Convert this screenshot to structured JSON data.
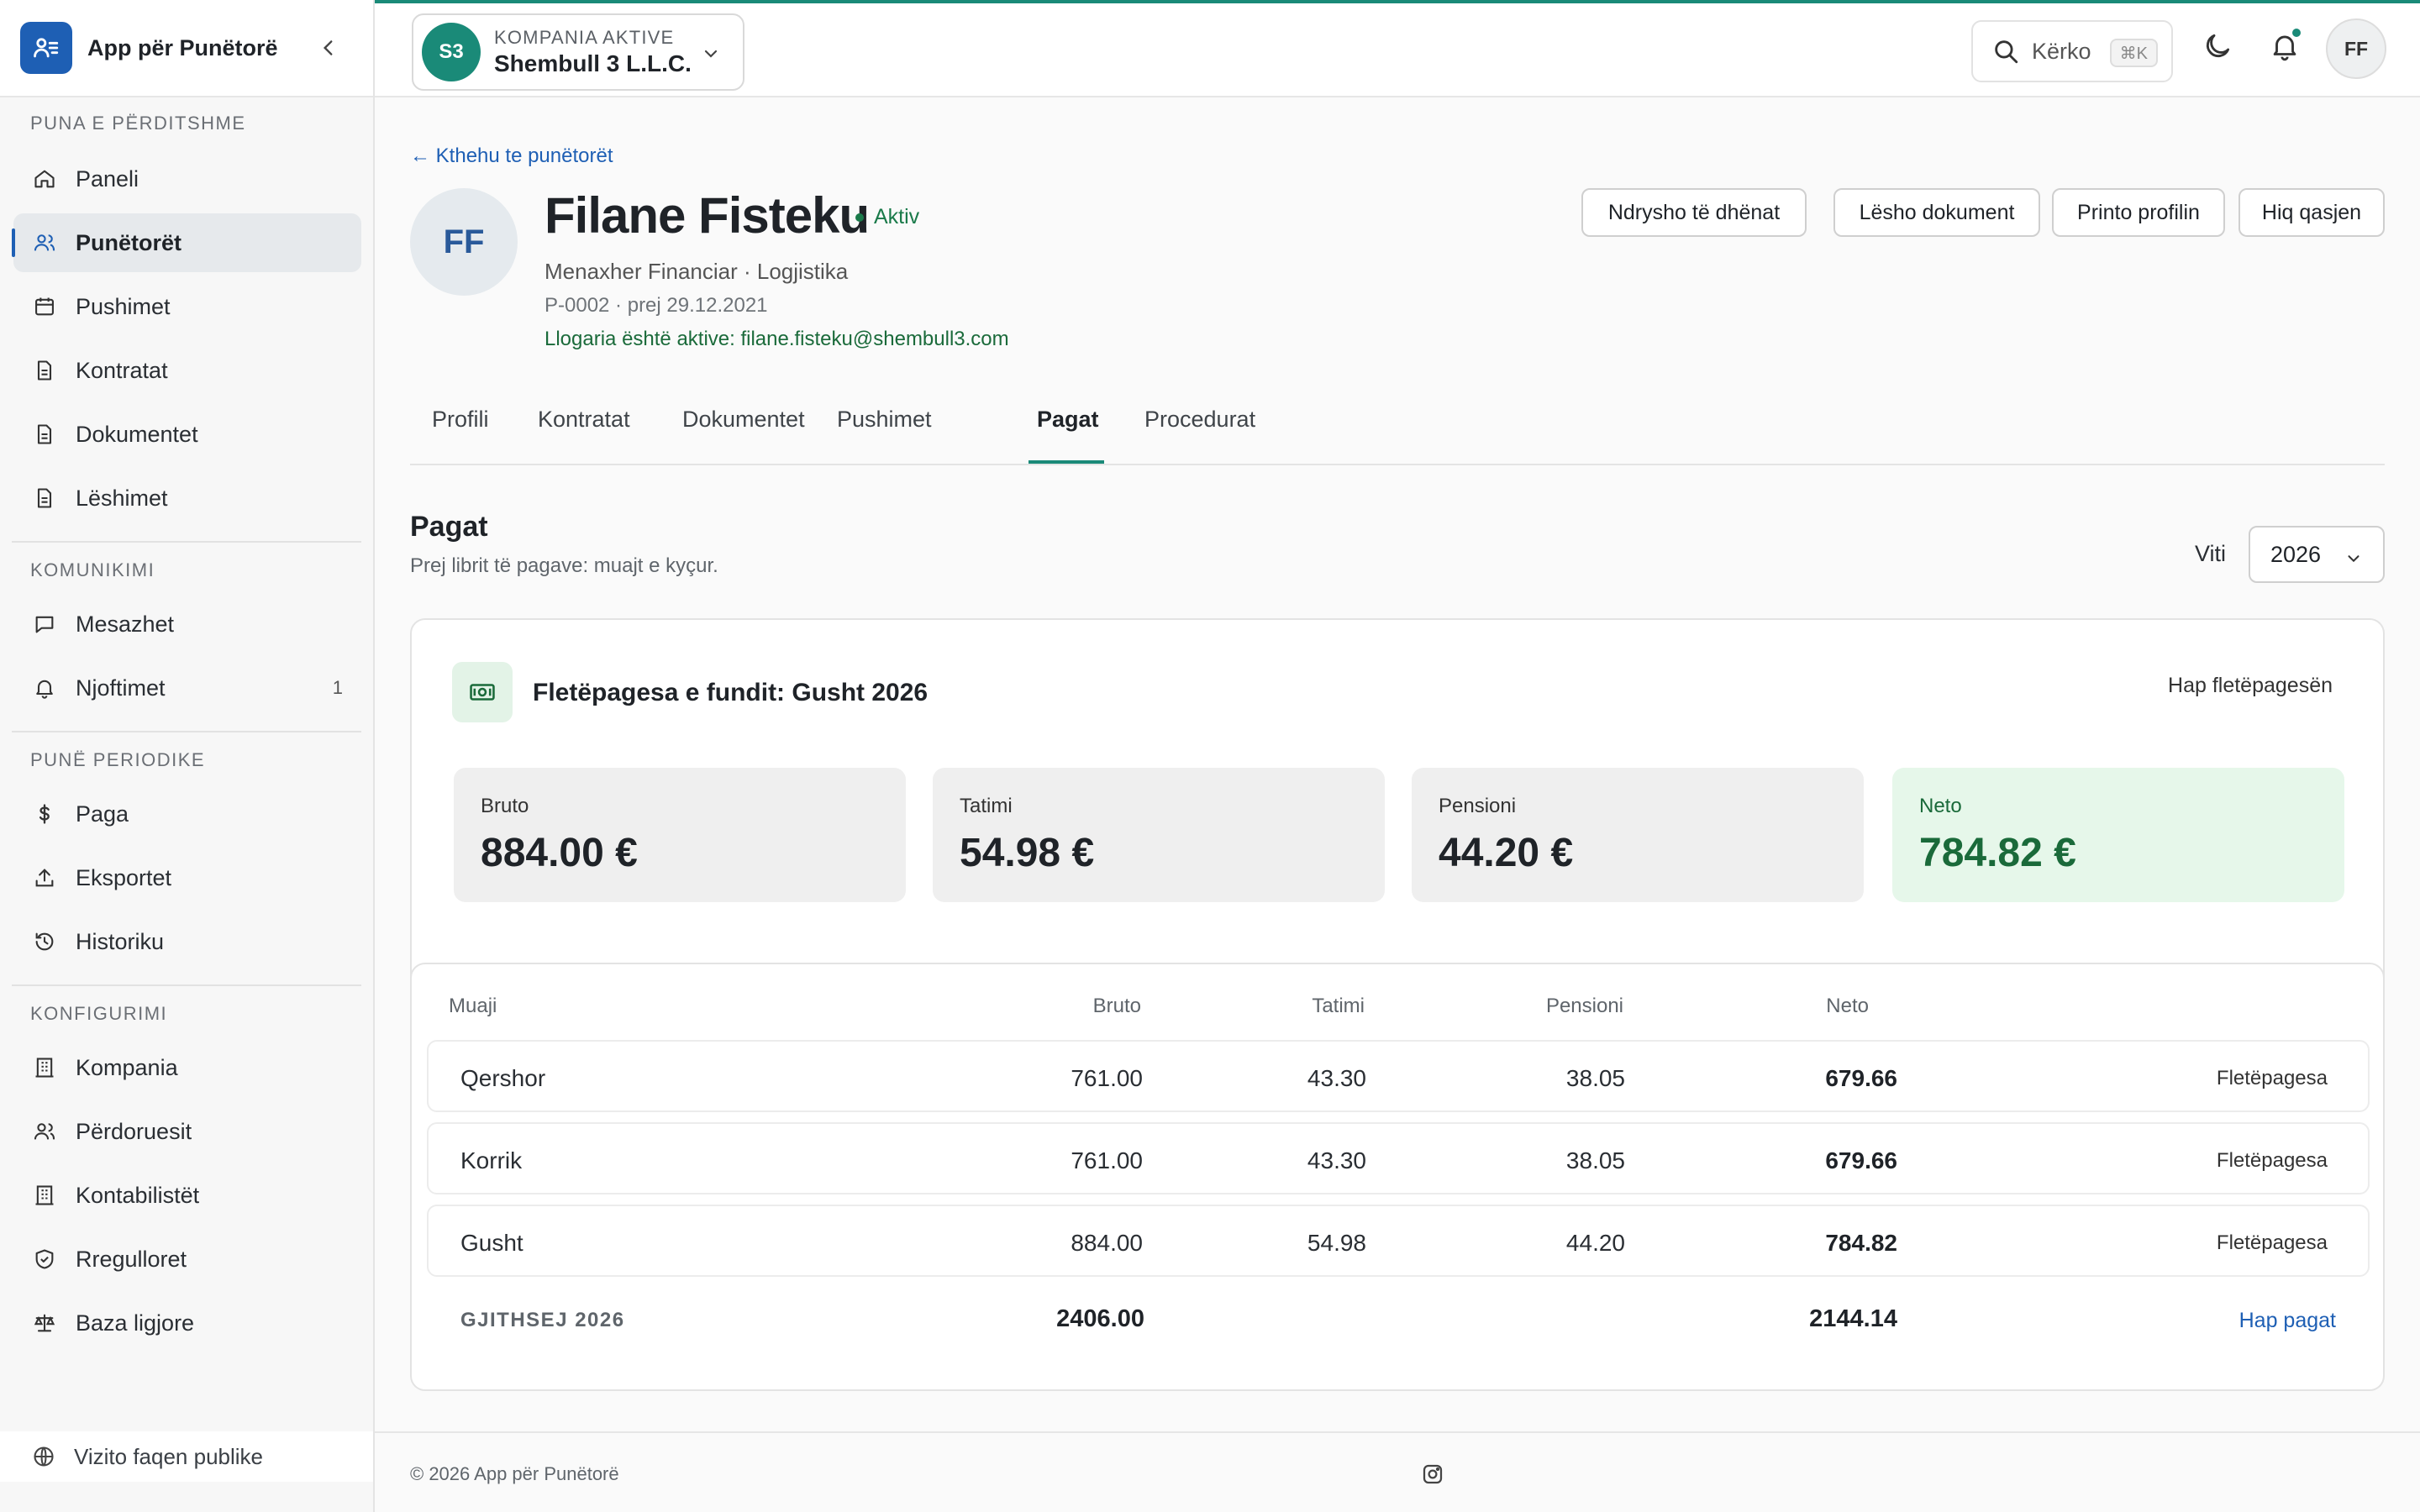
{
  "app": {
    "name": "App për Punëtorë"
  },
  "sidebar": {
    "sections": [
      {
        "title": "PUNA E PËRDITSHME"
      },
      {
        "title": "KOMUNIKIMI"
      },
      {
        "title": "PUNË PERIODIKE"
      },
      {
        "title": "KONFIGURIMI"
      }
    ],
    "items": [
      {
        "label": "Paneli",
        "icon": "home-icon"
      },
      {
        "label": "Punëtorët",
        "icon": "users-icon",
        "active": true
      },
      {
        "label": "Pushimet",
        "icon": "calendar-icon"
      },
      {
        "label": "Kontratat",
        "icon": "document-icon"
      },
      {
        "label": "Dokumentet",
        "icon": "document-icon"
      },
      {
        "label": "Lëshimet",
        "icon": "document-icon"
      },
      {
        "label": "Mesazhet",
        "icon": "message-icon"
      },
      {
        "label": "Njoftimet",
        "icon": "bell-icon",
        "count": "1"
      },
      {
        "label": "Paga",
        "icon": "dollar-icon"
      },
      {
        "label": "Eksportet",
        "icon": "upload-icon"
      },
      {
        "label": "Historiku",
        "icon": "history-icon"
      },
      {
        "label": "Kompania",
        "icon": "building-icon"
      },
      {
        "label": "Përdoruesit",
        "icon": "users-icon"
      },
      {
        "label": "Kontabilistët",
        "icon": "building-icon"
      },
      {
        "label": "Rregulloret",
        "icon": "shield-icon"
      },
      {
        "label": "Baza ligjore",
        "icon": "scale-icon"
      }
    ],
    "public_link": "Vizito faqen publike"
  },
  "header": {
    "company_label": "KOMPANIA AKTIVE",
    "company_name": "Shembull 3 L.L.C.",
    "company_initials": "S3",
    "search_label": "Kërko",
    "search_shortcut": "⌘K",
    "user_initials": "FF"
  },
  "employee": {
    "back_link": "← Kthehu te punëtorët",
    "initials": "FF",
    "name": "Filane Fisteku",
    "status": "Aktiv",
    "role": "Menaxher Financiar · Logjistika",
    "id_since": "P-0002 · prej 29.12.2021",
    "account": "Llogaria është aktive: filane.fisteku@shembull3.com",
    "actions": [
      "Ndrysho të dhënat",
      "Lësho dokument",
      "Printo profilin",
      "Hiq qasjen"
    ]
  },
  "tabs": [
    "Profili",
    "Kontratat",
    "Dokumentet",
    "Pushimet",
    "Pagat",
    "Procedurat"
  ],
  "active_tab": "Pagat",
  "pagat": {
    "title": "Pagat",
    "subtitle": "Prej librit të pagave: muajt e kyçur.",
    "year_label": "Viti",
    "year": "2026",
    "latest": {
      "title": "Fletëpagesa e fundit: Gusht 2026",
      "open_label": "Hap fletëpagesën",
      "stats": [
        {
          "label": "Bruto",
          "value": "884.00 €"
        },
        {
          "label": "Tatimi",
          "value": "54.98 €"
        },
        {
          "label": "Pensioni",
          "value": "44.20 €"
        },
        {
          "label": "Neto",
          "value": "784.82 €"
        }
      ]
    },
    "table": {
      "columns": [
        "Muaji",
        "Bruto",
        "Tatimi",
        "Pensioni",
        "Neto"
      ],
      "rows": [
        {
          "month": "Qershor",
          "bruto": "761.00",
          "tatimi": "43.30",
          "pensioni": "38.05",
          "neto": "679.66",
          "link": "Fletëpagesa"
        },
        {
          "month": "Korrik",
          "bruto": "761.00",
          "tatimi": "43.30",
          "pensioni": "38.05",
          "neto": "679.66",
          "link": "Fletëpagesa"
        },
        {
          "month": "Gusht",
          "bruto": "884.00",
          "tatimi": "54.98",
          "pensioni": "44.20",
          "neto": "784.82",
          "link": "Fletëpagesa"
        }
      ],
      "total_label": "GJITHSEJ 2026",
      "total_bruto": "2406.00",
      "total_neto": "2144.14",
      "total_link": "Hap pagat"
    }
  },
  "footer": {
    "text": "© 2026 App për Punëtorë"
  },
  "colors": {
    "accent": "#1a8a78",
    "brand": "#1e5fb4",
    "success": "#1a6a3a"
  }
}
